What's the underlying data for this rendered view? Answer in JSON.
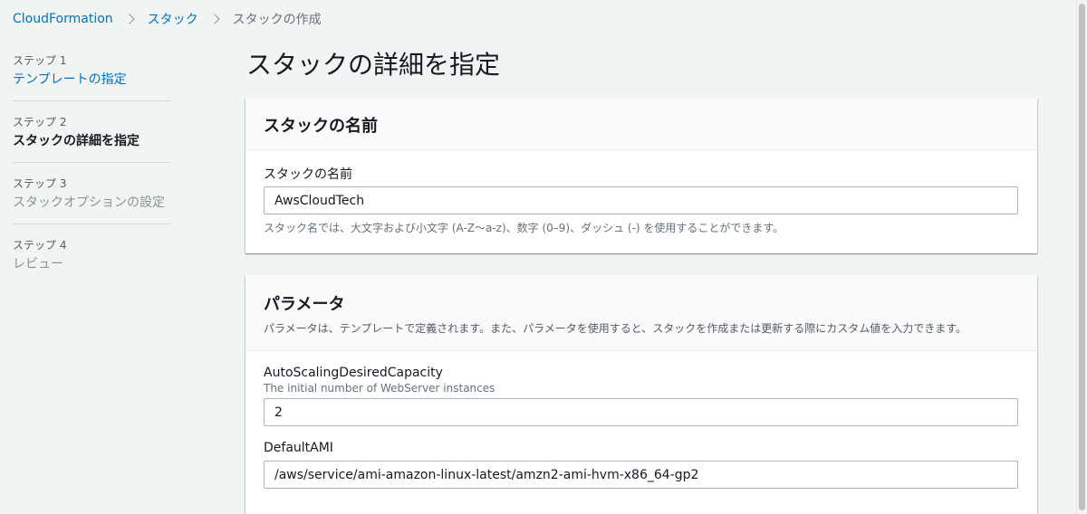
{
  "breadcrumb": {
    "items": [
      "CloudFormation",
      "スタック",
      "スタックの作成"
    ]
  },
  "steps": [
    {
      "number": "ステップ 1",
      "label": "テンプレートの指定",
      "state": "link"
    },
    {
      "number": "ステップ 2",
      "label": "スタックの詳細を指定",
      "state": "current"
    },
    {
      "number": "ステップ 3",
      "label": "スタックオプションの設定",
      "state": "disabled"
    },
    {
      "number": "ステップ 4",
      "label": "レビュー",
      "state": "disabled"
    }
  ],
  "page": {
    "title": "スタックの詳細を指定"
  },
  "stack_name_panel": {
    "header": "スタックの名前",
    "field_label": "スタックの名前",
    "value": "AwsCloudTech",
    "hint": "スタック名では、大文字および小文字 (A-Z〜a-z)、数字 (0–9)、ダッシュ (-) を使用することができます。"
  },
  "parameters_panel": {
    "header": "パラメータ",
    "description": "パラメータは、テンプレートで定義されます。また、パラメータを使用すると、スタックを作成または更新する際にカスタム値を入力できます。",
    "fields": [
      {
        "label": "AutoScalingDesiredCapacity",
        "description": "The initial number of WebServer instances",
        "value": "2"
      },
      {
        "label": "DefaultAMI",
        "description": "",
        "value": "/aws/service/ami-amazon-linux-latest/amzn2-ami-hvm-x86_64-gp2"
      }
    ]
  },
  "colors": {
    "link": "#0073bb",
    "background": "#f2f3f3",
    "panel_header": "#fafafa"
  }
}
